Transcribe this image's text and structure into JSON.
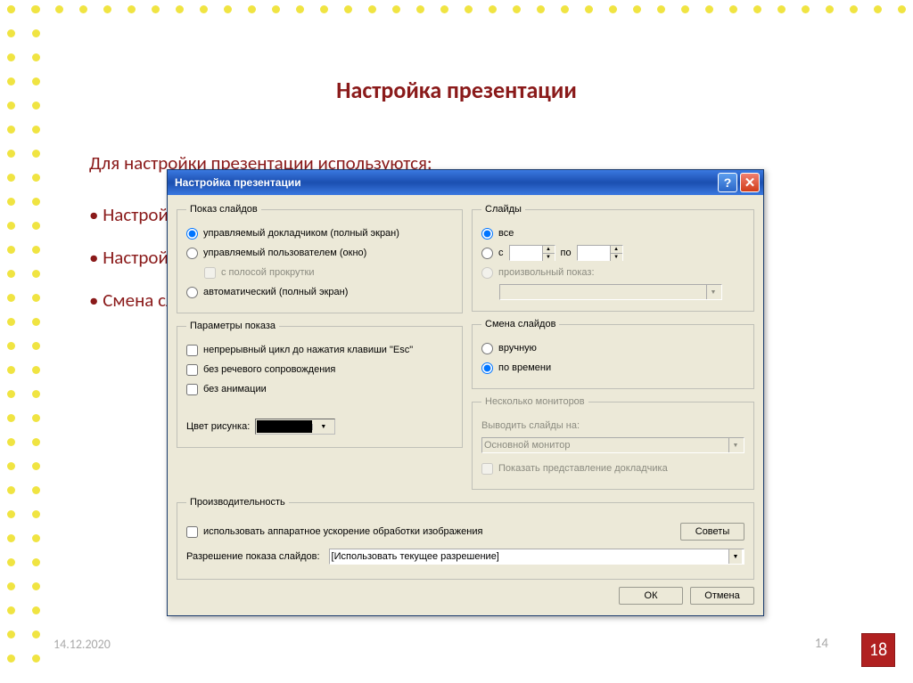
{
  "slide": {
    "title": "Настройка презентации",
    "intro": "Для настройки презентации используются:",
    "bullets": [
      "Настройка презентации,",
      "Настройка времени,",
      "Смена слайдов"
    ],
    "date": "14.12.2020",
    "page_gray": "14",
    "page_red": "18"
  },
  "dialog": {
    "title": "Настройка презентации",
    "groups": {
      "show_type": {
        "legend": "Показ слайдов",
        "opt_presenter": "управляемый докладчиком (полный экран)",
        "opt_user": "управляемый пользователем (окно)",
        "opt_scrollbar": "с полосой прокрутки",
        "opt_auto": "автоматический (полный экран)"
      },
      "show_params": {
        "legend": "Параметры показа",
        "chk_loop": "непрерывный цикл до нажатия клавиши \"Esc\"",
        "chk_no_voice": "без речевого сопровождения",
        "chk_no_anim": "без анимации",
        "pen_color_label": "Цвет рисунка:"
      },
      "slides": {
        "legend": "Слайды",
        "opt_all": "все",
        "opt_from": "с",
        "to_label": "по",
        "opt_custom": "произвольный показ:"
      },
      "advance": {
        "legend": "Смена слайдов",
        "opt_manual": "вручную",
        "opt_timing": "по времени"
      },
      "monitors": {
        "legend": "Несколько мониторов",
        "output_label": "Выводить слайды на:",
        "monitor_value": "Основной монитор",
        "chk_presenter_view": "Показать представление докладчика"
      },
      "performance": {
        "legend": "Производительность",
        "chk_hw_accel": "использовать аппаратное ускорение обработки изображения",
        "hints_btn": "Советы",
        "resolution_label": "Разрешение показа слайдов:",
        "resolution_value": "[Использовать текущее разрешение]"
      }
    },
    "buttons": {
      "ok": "ОК",
      "cancel": "Отмена"
    }
  }
}
